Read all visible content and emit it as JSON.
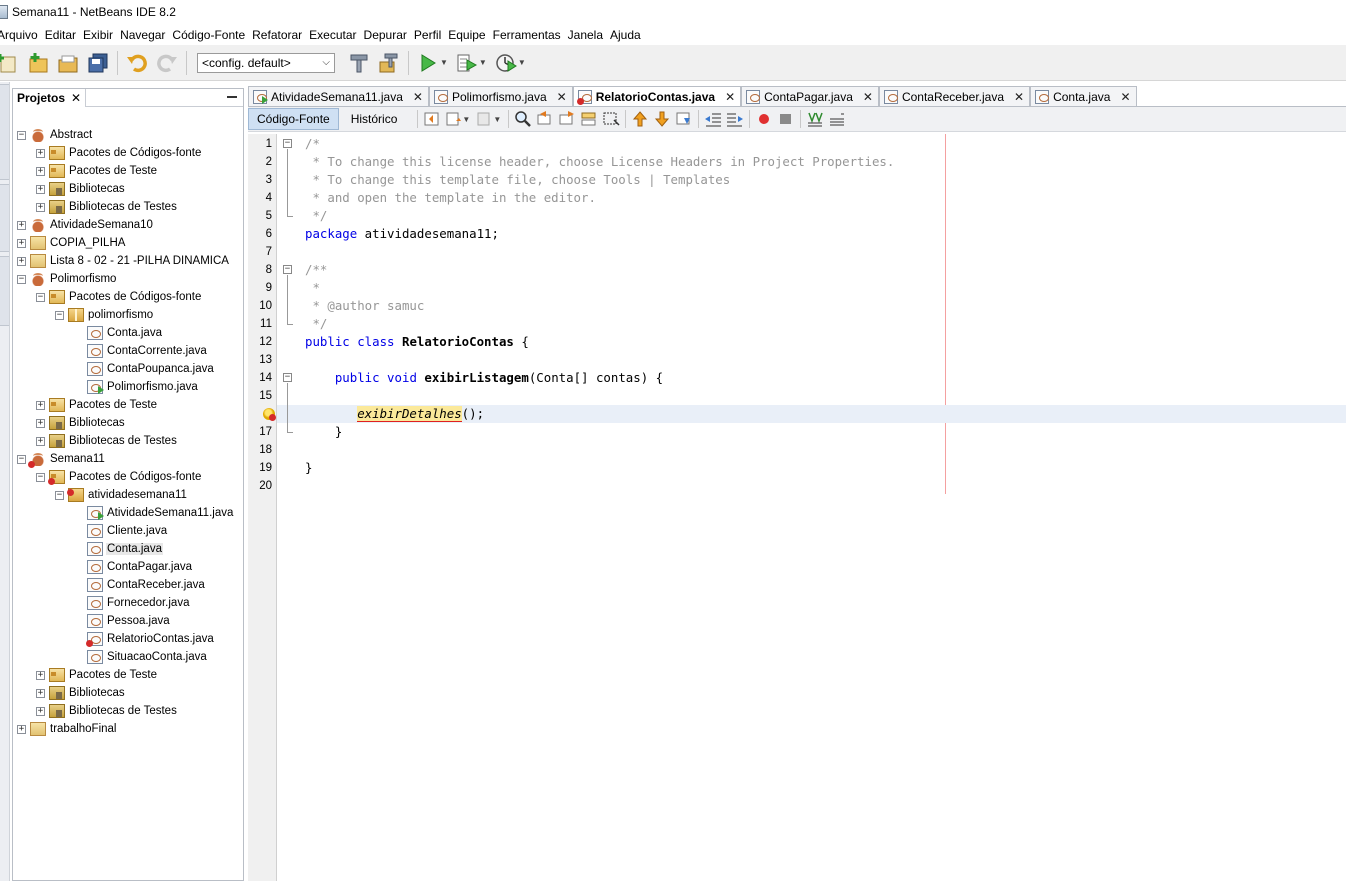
{
  "window": {
    "title": "Semana11 - NetBeans IDE 8.2"
  },
  "menu": [
    "Arquivo",
    "Editar",
    "Exibir",
    "Navegar",
    "Código-Fonte",
    "Refatorar",
    "Executar",
    "Depurar",
    "Perfil",
    "Equipe",
    "Ferramentas",
    "Janela",
    "Ajuda"
  ],
  "toolbar": {
    "config_value": "<config. default>"
  },
  "projects_panel": {
    "tab_label": "Projetos",
    "close": "✕"
  },
  "tree": [
    {
      "depth": 0,
      "toggle": "−",
      "icon": "project",
      "label": "Abstract"
    },
    {
      "depth": 1,
      "toggle": "+",
      "icon": "folder-pkg",
      "label": "Pacotes de Códigos-fonte"
    },
    {
      "depth": 1,
      "toggle": "+",
      "icon": "folder-pkg",
      "label": "Pacotes de Teste"
    },
    {
      "depth": 1,
      "toggle": "+",
      "icon": "lib",
      "label": "Bibliotecas"
    },
    {
      "depth": 1,
      "toggle": "+",
      "icon": "lib",
      "label": "Bibliotecas de Testes"
    },
    {
      "depth": 0,
      "toggle": "+",
      "icon": "project",
      "label": "AtividadeSemana10"
    },
    {
      "depth": 0,
      "toggle": "+",
      "icon": "project-plain",
      "label": "COPIA_PILHA"
    },
    {
      "depth": 0,
      "toggle": "+",
      "icon": "project-plain",
      "label": "Lista 8 - 02 - 21 -PILHA DINAMICA"
    },
    {
      "depth": 0,
      "toggle": "−",
      "icon": "project",
      "label": "Polimorfismo"
    },
    {
      "depth": 1,
      "toggle": "−",
      "icon": "folder-pkg",
      "label": "Pacotes de Códigos-fonte"
    },
    {
      "depth": 2,
      "toggle": "−",
      "icon": "package",
      "label": "polimorfismo"
    },
    {
      "depth": 3,
      "toggle": "",
      "icon": "java",
      "label": "Conta.java"
    },
    {
      "depth": 3,
      "toggle": "",
      "icon": "java",
      "label": "ContaCorrente.java"
    },
    {
      "depth": 3,
      "toggle": "",
      "icon": "java",
      "label": "ContaPoupanca.java"
    },
    {
      "depth": 3,
      "toggle": "",
      "icon": "java-main",
      "label": "Polimorfismo.java"
    },
    {
      "depth": 1,
      "toggle": "+",
      "icon": "folder-pkg",
      "label": "Pacotes de Teste"
    },
    {
      "depth": 1,
      "toggle": "+",
      "icon": "lib",
      "label": "Bibliotecas"
    },
    {
      "depth": 1,
      "toggle": "+",
      "icon": "lib",
      "label": "Bibliotecas de Testes"
    },
    {
      "depth": 0,
      "toggle": "−",
      "icon": "project-err",
      "label": "Semana11"
    },
    {
      "depth": 1,
      "toggle": "−",
      "icon": "folder-pkg-err",
      "label": "Pacotes de Códigos-fonte"
    },
    {
      "depth": 2,
      "toggle": "−",
      "icon": "package-err",
      "label": "atividadesemana11"
    },
    {
      "depth": 3,
      "toggle": "",
      "icon": "java-main",
      "label": "AtividadeSemana11.java"
    },
    {
      "depth": 3,
      "toggle": "",
      "icon": "java",
      "label": "Cliente.java"
    },
    {
      "depth": 3,
      "toggle": "",
      "icon": "java",
      "label": "Conta.java",
      "selected": true
    },
    {
      "depth": 3,
      "toggle": "",
      "icon": "java",
      "label": "ContaPagar.java"
    },
    {
      "depth": 3,
      "toggle": "",
      "icon": "java",
      "label": "ContaReceber.java"
    },
    {
      "depth": 3,
      "toggle": "",
      "icon": "java",
      "label": "Fornecedor.java"
    },
    {
      "depth": 3,
      "toggle": "",
      "icon": "java",
      "label": "Pessoa.java"
    },
    {
      "depth": 3,
      "toggle": "",
      "icon": "java-err",
      "label": "RelatorioContas.java"
    },
    {
      "depth": 3,
      "toggle": "",
      "icon": "java",
      "label": "SituacaoConta.java"
    },
    {
      "depth": 1,
      "toggle": "+",
      "icon": "folder-pkg",
      "label": "Pacotes de Teste"
    },
    {
      "depth": 1,
      "toggle": "+",
      "icon": "lib",
      "label": "Bibliotecas"
    },
    {
      "depth": 1,
      "toggle": "+",
      "icon": "lib",
      "label": "Bibliotecas de Testes"
    },
    {
      "depth": 0,
      "toggle": "+",
      "icon": "project-plain",
      "label": "trabalhoFinal"
    }
  ],
  "editor_tabs": [
    {
      "label": "AtividadeSemana11.java",
      "active": false
    },
    {
      "label": "Polimorfismo.java",
      "active": false
    },
    {
      "label": "RelatorioContas.java",
      "active": true
    },
    {
      "label": "ContaPagar.java",
      "active": false
    },
    {
      "label": "ContaReceber.java",
      "active": false
    },
    {
      "label": "Conta.java",
      "active": false
    }
  ],
  "editor_tab_close": "✕",
  "editor_subtabs": [
    "Código-Fonte",
    "Histórico"
  ],
  "code_lines": [
    {
      "n": "1",
      "parts": [
        [
          "c",
          "/*"
        ]
      ]
    },
    {
      "n": "2",
      "parts": [
        [
          "c",
          " * To change this license header, choose License Headers in Project Properties."
        ]
      ]
    },
    {
      "n": "3",
      "parts": [
        [
          "c",
          " * To change this template file, choose Tools | Templates"
        ]
      ]
    },
    {
      "n": "4",
      "parts": [
        [
          "c",
          " * and open the template in the editor."
        ]
      ]
    },
    {
      "n": "5",
      "parts": [
        [
          "c",
          " */"
        ]
      ]
    },
    {
      "n": "6",
      "parts": [
        [
          "k",
          "package"
        ],
        [
          "n",
          " atividadesemana11;"
        ]
      ]
    },
    {
      "n": "7",
      "parts": []
    },
    {
      "n": "8",
      "parts": [
        [
          "c",
          "/**"
        ]
      ]
    },
    {
      "n": "9",
      "parts": [
        [
          "c",
          " *"
        ]
      ]
    },
    {
      "n": "10",
      "parts": [
        [
          "c",
          " * @author samuc"
        ]
      ]
    },
    {
      "n": "11",
      "parts": [
        [
          "c",
          " */"
        ]
      ]
    },
    {
      "n": "12",
      "parts": [
        [
          "k",
          "public class"
        ],
        [
          "n",
          " "
        ],
        [
          "b",
          "RelatorioContas"
        ],
        [
          "n",
          " {"
        ]
      ]
    },
    {
      "n": "13",
      "parts": []
    },
    {
      "n": "14",
      "parts": [
        [
          "n",
          "    "
        ],
        [
          "k",
          "public void"
        ],
        [
          "n",
          " "
        ],
        [
          "b",
          "exibirListagem"
        ],
        [
          "n",
          "(Conta[] contas) {"
        ]
      ]
    },
    {
      "n": "15",
      "parts": []
    },
    {
      "n": "",
      "parts": [
        [
          "n",
          "       "
        ],
        [
          "e",
          "exibirDetalhes"
        ],
        [
          "n",
          "();"
        ]
      ],
      "current": true,
      "hint": true
    },
    {
      "n": "17",
      "parts": [
        [
          "n",
          "    }"
        ]
      ]
    },
    {
      "n": "18",
      "parts": []
    },
    {
      "n": "19",
      "parts": [
        [
          "n",
          "}"
        ]
      ]
    },
    {
      "n": "20",
      "parts": []
    }
  ]
}
